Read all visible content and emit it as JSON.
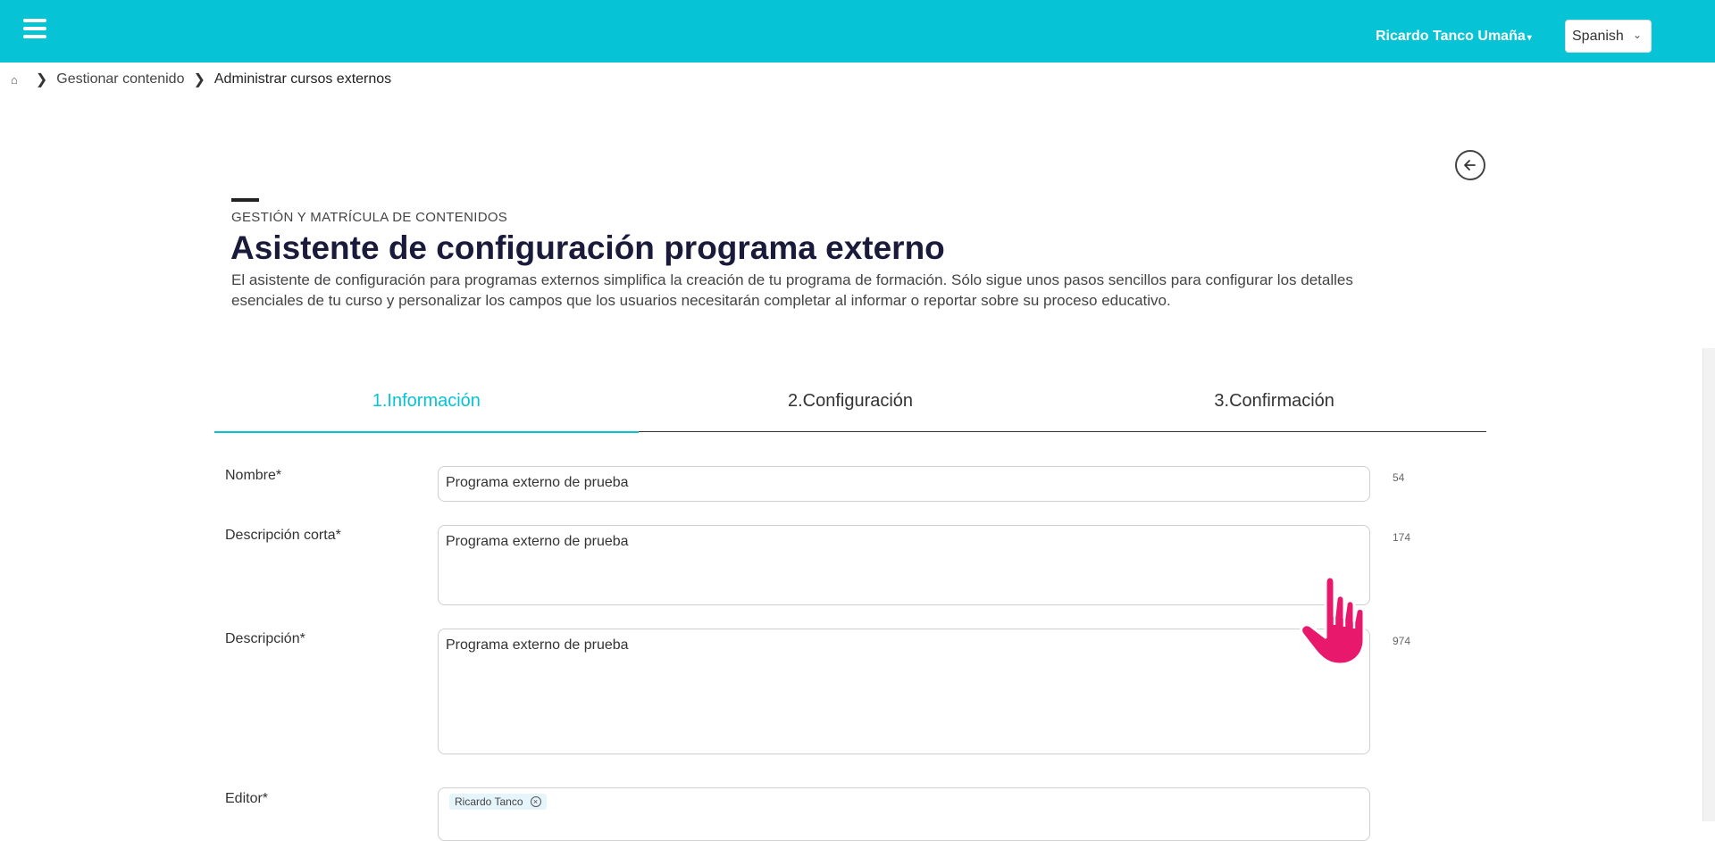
{
  "header": {
    "user_name": "Ricardo Tanco Umaña",
    "language": "Spanish",
    "accent_color": "#06c3d6"
  },
  "breadcrumb": {
    "items": [
      "Gestionar contenido",
      "Administrar cursos externos"
    ]
  },
  "page": {
    "eyebrow": "GESTIÓN Y MATRÍCULA DE CONTENIDOS",
    "title": "Asistente de configuración programa externo",
    "description": "El asistente de configuración para programas externos simplifica la creación de tu programa de formación. Sólo sigue unos pasos sencillos para configurar los detalles esenciales de tu curso y personalizar los campos que los usuarios necesitarán completar al informar o reportar sobre su proceso educativo."
  },
  "tabs": [
    {
      "label": "1.Información",
      "active": true
    },
    {
      "label": "2.Configuración",
      "active": false
    },
    {
      "label": "3.Confirmación",
      "active": false
    }
  ],
  "form": {
    "nombre": {
      "label": "Nombre*",
      "value": "Programa externo de prueba",
      "count": "54"
    },
    "descripcion_corta": {
      "label": "Descripción corta*",
      "value": "Programa externo de prueba",
      "count": "174"
    },
    "descripcion": {
      "label": "Descripción*",
      "value": "Programa externo de prueba",
      "count": "974"
    },
    "editor": {
      "label": "Editor*",
      "tag": "Ricardo Tanco"
    }
  }
}
